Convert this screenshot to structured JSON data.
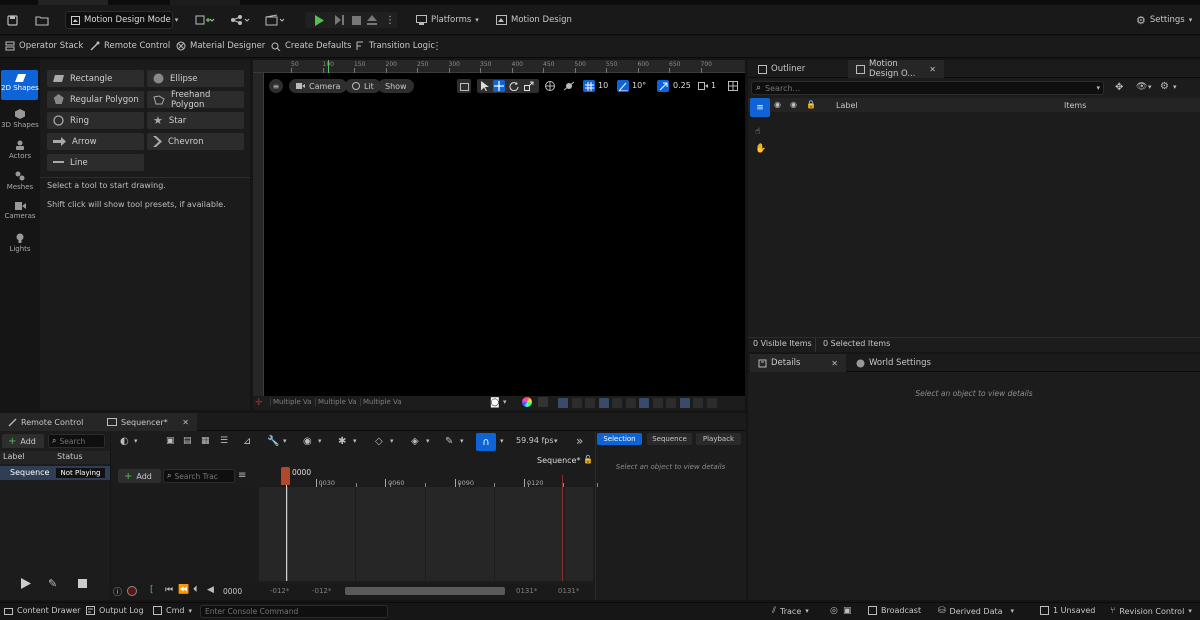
{
  "topbar": {
    "mode_label": "Motion Design Mode",
    "platforms_label": "Platforms",
    "motion_design_label": "Motion Design",
    "settings_label": "Settings"
  },
  "toolbar2": {
    "items": [
      "Operator Stack",
      "Remote Control",
      "Material Designer",
      "Create Defaults",
      "Transition Logic"
    ]
  },
  "left_panel": {
    "categories": [
      "2D Shapes",
      "3D Shapes",
      "Actors",
      "Meshes",
      "Cameras",
      "Lights"
    ],
    "shapes": [
      "Rectangle",
      "Ellipse",
      "Regular Polygon",
      "Freehand Polygon",
      "Ring",
      "Star",
      "Arrow",
      "Chevron",
      "Line"
    ],
    "hint1": "Select a tool to start drawing.",
    "hint2": "Shift click will show tool presets, if available."
  },
  "viewport": {
    "camera_label": "Camera",
    "lit_label": "Lit",
    "show_label": "Show",
    "grid_value": "10",
    "angle_value": "10°",
    "scale_value": "0.25",
    "speed_value": "1",
    "ruler_ticks": [
      "50",
      "100",
      "150",
      "200",
      "250",
      "300",
      "350",
      "400",
      "450",
      "500",
      "550",
      "600",
      "650",
      "700"
    ],
    "bottom_labels": [
      "Multiple Va",
      "Multiple Va",
      "Multiple Va"
    ]
  },
  "outliner": {
    "tab_outliner": "Outliner",
    "tab_motion": "Motion Design O...",
    "search_placeholder": "Search...",
    "col_label": "Label",
    "col_items": "Items",
    "visible_items": "0  Visible Items",
    "selected_items": "0  Selected Items"
  },
  "details": {
    "tab_details": "Details",
    "tab_world": "World Settings",
    "empty": "Select an object to view details"
  },
  "remote_control": {
    "tab": "Remote Control",
    "add_label": "Add",
    "search_placeholder": "Search",
    "col_label": "Label",
    "col_status": "Status",
    "row_label": "Sequence",
    "row_status": "Not Playing"
  },
  "sequencer": {
    "tab": "Sequencer*",
    "fps": "59.94 fps",
    "name": "Sequence*",
    "add_label": "Add",
    "search_placeholder": "Search Trac",
    "timecode": "0000",
    "ticks": [
      "0030",
      "0060",
      "0090",
      "0120"
    ],
    "frame": "0000",
    "range_start": "-012*",
    "range_start2": "-012*",
    "range_end": "0131*",
    "range_end2": "0131*"
  },
  "seq_details": {
    "tabs": [
      "Selection",
      "Sequence",
      "Playback"
    ],
    "empty": "Select an object to view details"
  },
  "statusbar": {
    "content_drawer": "Content Drawer",
    "output_log": "Output Log",
    "cmd": "Cmd",
    "console_placeholder": "Enter Console Command",
    "trace": "Trace",
    "broadcast": "Broadcast",
    "derived_data": "Derived Data",
    "unsaved": "1 Unsaved",
    "revision_control": "Revision Control"
  }
}
